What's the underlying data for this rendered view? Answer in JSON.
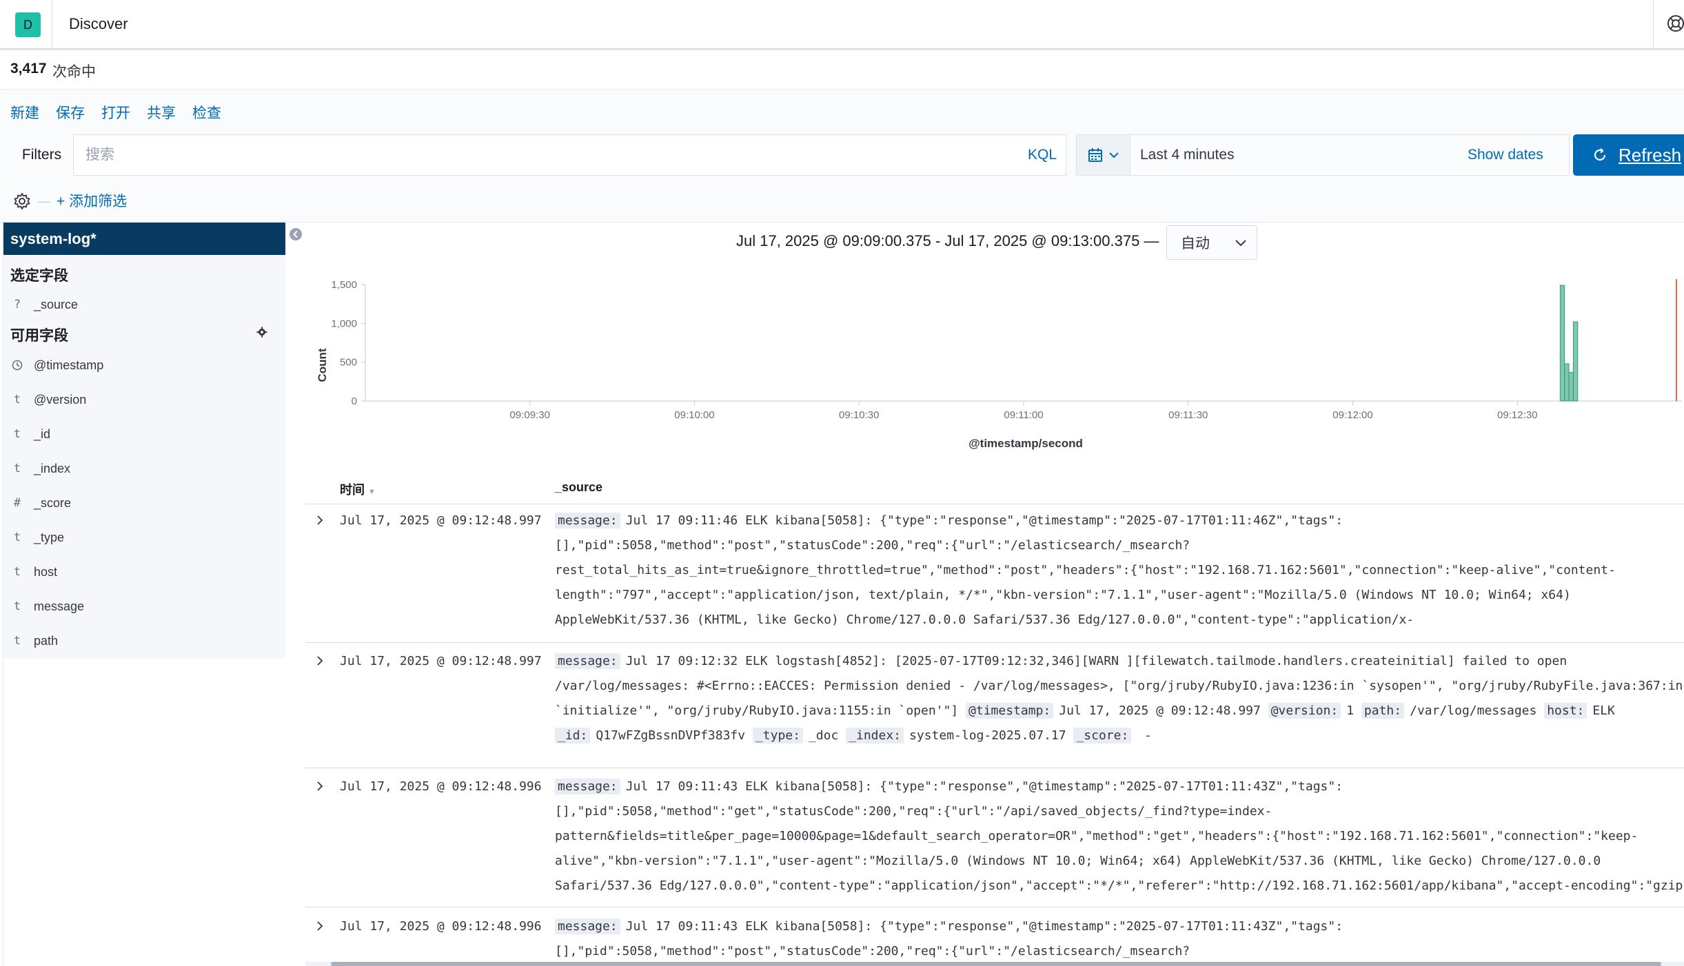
{
  "header": {
    "space_initial": "D",
    "app_title": "Discover"
  },
  "hits": {
    "count": "3,417",
    "label": "次命中"
  },
  "top_nav": {
    "new": "新建",
    "save": "保存",
    "open": "打开",
    "share": "共享",
    "inspect": "检查"
  },
  "query_bar": {
    "filters_label": "Filters",
    "search_placeholder": "搜索",
    "kql_label": "KQL",
    "date_range": "Last 4 minutes",
    "show_dates": "Show dates",
    "refresh_label": "Refresh"
  },
  "filter_row": {
    "add_filter": "+ 添加筛选"
  },
  "sidebar": {
    "index_pattern": "system-log*",
    "selected_title": "选定字段",
    "selected_fields": [
      {
        "type": "?",
        "name": "_source"
      }
    ],
    "available_title": "可用字段",
    "available_fields": [
      {
        "type": "clock",
        "name": "@timestamp"
      },
      {
        "type": "t",
        "name": "@version"
      },
      {
        "type": "t",
        "name": "_id"
      },
      {
        "type": "t",
        "name": "_index"
      },
      {
        "type": "#",
        "name": "_score"
      },
      {
        "type": "t",
        "name": "_type"
      },
      {
        "type": "t",
        "name": "host"
      },
      {
        "type": "t",
        "name": "message"
      },
      {
        "type": "t",
        "name": "path"
      }
    ]
  },
  "histogram": {
    "range_label": "Jul 17, 2025 @ 09:09:00.375 - Jul 17, 2025 @ 09:13:00.375 —",
    "interval": "自动"
  },
  "chart_data": {
    "type": "bar",
    "xlabel": "@timestamp/second",
    "ylabel": "Count",
    "x_ticks": [
      "09:09:30",
      "09:10:00",
      "09:10:30",
      "09:11:00",
      "09:11:30",
      "09:12:00",
      "09:12:30"
    ],
    "y_ticks": [
      "0",
      "500",
      "1,000",
      "1,500"
    ],
    "ylim": [
      0,
      1500
    ],
    "x_range_seconds": [
      0,
      240
    ],
    "bars": [
      {
        "t": 218.2,
        "count": 1490
      },
      {
        "t": 219.0,
        "count": 480
      },
      {
        "t": 219.8,
        "count": 370
      },
      {
        "t": 220.6,
        "count": 1020
      }
    ],
    "bar_color": "#54b399",
    "now_line_color": "#e7664c"
  },
  "table": {
    "col_time": "时间",
    "col_source": "_source",
    "rows": [
      {
        "time": "Jul 17, 2025 @ 09:12:48.997",
        "lines": [
          [
            {
              "k": "message:"
            },
            {
              "v": "Jul 17 09:11:46 ELK kibana[5058]: {\"type\":\"response\",\"@timestamp\":\"2025-07-17T01:11:46Z\",\"tags\":"
            }
          ],
          [
            {
              "v": "[],\"pid\":5058,\"method\":\"post\",\"statusCode\":200,\"req\":{\"url\":\"/elasticsearch/_msearch?"
            }
          ],
          [
            {
              "v": "rest_total_hits_as_int=true&ignore_throttled=true\",\"method\":\"post\",\"headers\":{\"host\":\"192.168.71.162:5601\",\"connection\":\"keep-alive\",\"content-"
            }
          ],
          [
            {
              "v": "length\":\"797\",\"accept\":\"application/json, text/plain, */*\",\"kbn-version\":\"7.1.1\",\"user-agent\":\"Mozilla/5.0 (Windows NT 10.0; Win64; x64)"
            }
          ],
          [
            {
              "v": "AppleWebKit/537.36 (KHTML, like Gecko) Chrome/127.0.0.0 Safari/537.36 Edg/127.0.0.0\",\"content-type\":\"application/x-"
            }
          ]
        ]
      },
      {
        "time": "Jul 17, 2025 @ 09:12:48.997",
        "lines": [
          [
            {
              "k": "message:"
            },
            {
              "v": "Jul 17 09:12:32 ELK logstash[4852]: [2025-07-17T09:12:32,346][WARN ][filewatch.tailmode.handlers.createinitial] failed to open"
            }
          ],
          [
            {
              "v": "/var/log/messages: #<Errno::EACCES: Permission denied - /var/log/messages>, [\"org/jruby/RubyIO.java:1236:in `sysopen'\", \"org/jruby/RubyFile.java:367:in"
            }
          ],
          [
            {
              "v": "`initialize'\", \"org/jruby/RubyIO.java:1155:in `open'\"] "
            },
            {
              "k": "@timestamp:"
            },
            {
              "v": "Jul 17, 2025 @ 09:12:48.997 "
            },
            {
              "k": "@version:"
            },
            {
              "v": "1 "
            },
            {
              "k": "path:"
            },
            {
              "v": "/var/log/messages "
            },
            {
              "k": "host:"
            },
            {
              "v": "ELK"
            }
          ],
          [
            {
              "k": "_id:"
            },
            {
              "v": "Q17wFZgBssnDVPf383fv "
            },
            {
              "k": "_type:"
            },
            {
              "v": "_doc "
            },
            {
              "k": "_index:"
            },
            {
              "v": "system-log-2025.07.17 "
            },
            {
              "k": "_score:"
            },
            {
              "v": " -"
            }
          ]
        ]
      },
      {
        "time": "Jul 17, 2025 @ 09:12:48.996",
        "lines": [
          [
            {
              "k": "message:"
            },
            {
              "v": "Jul 17 09:11:43 ELK kibana[5058]: {\"type\":\"response\",\"@timestamp\":\"2025-07-17T01:11:43Z\",\"tags\":"
            }
          ],
          [
            {
              "v": "[],\"pid\":5058,\"method\":\"get\",\"statusCode\":200,\"req\":{\"url\":\"/api/saved_objects/_find?type=index-"
            }
          ],
          [
            {
              "v": "pattern&fields=title&per_page=10000&page=1&default_search_operator=OR\",\"method\":\"get\",\"headers\":{\"host\":\"192.168.71.162:5601\",\"connection\":\"keep-"
            }
          ],
          [
            {
              "v": "alive\",\"kbn-version\":\"7.1.1\",\"user-agent\":\"Mozilla/5.0 (Windows NT 10.0; Win64; x64) AppleWebKit/537.36 (KHTML, like Gecko) Chrome/127.0.0.0"
            }
          ],
          [
            {
              "v": "Safari/537.36 Edg/127.0.0.0\",\"content-type\":\"application/json\",\"accept\":\"*/*\",\"referer\":\"http://192.168.71.162:5601/app/kibana\",\"accept-encoding\":\"gzip,"
            }
          ]
        ]
      },
      {
        "time": "Jul 17, 2025 @ 09:12:48.996",
        "lines": [
          [
            {
              "k": "message:"
            },
            {
              "v": "Jul 17 09:11:43 ELK kibana[5058]: {\"type\":\"response\",\"@timestamp\":\"2025-07-17T01:11:43Z\",\"tags\":"
            }
          ],
          [
            {
              "v": "[],\"pid\":5058,\"method\":\"post\",\"statusCode\":200,\"req\":{\"url\":\"/elasticsearch/_msearch?"
            }
          ]
        ]
      }
    ]
  }
}
